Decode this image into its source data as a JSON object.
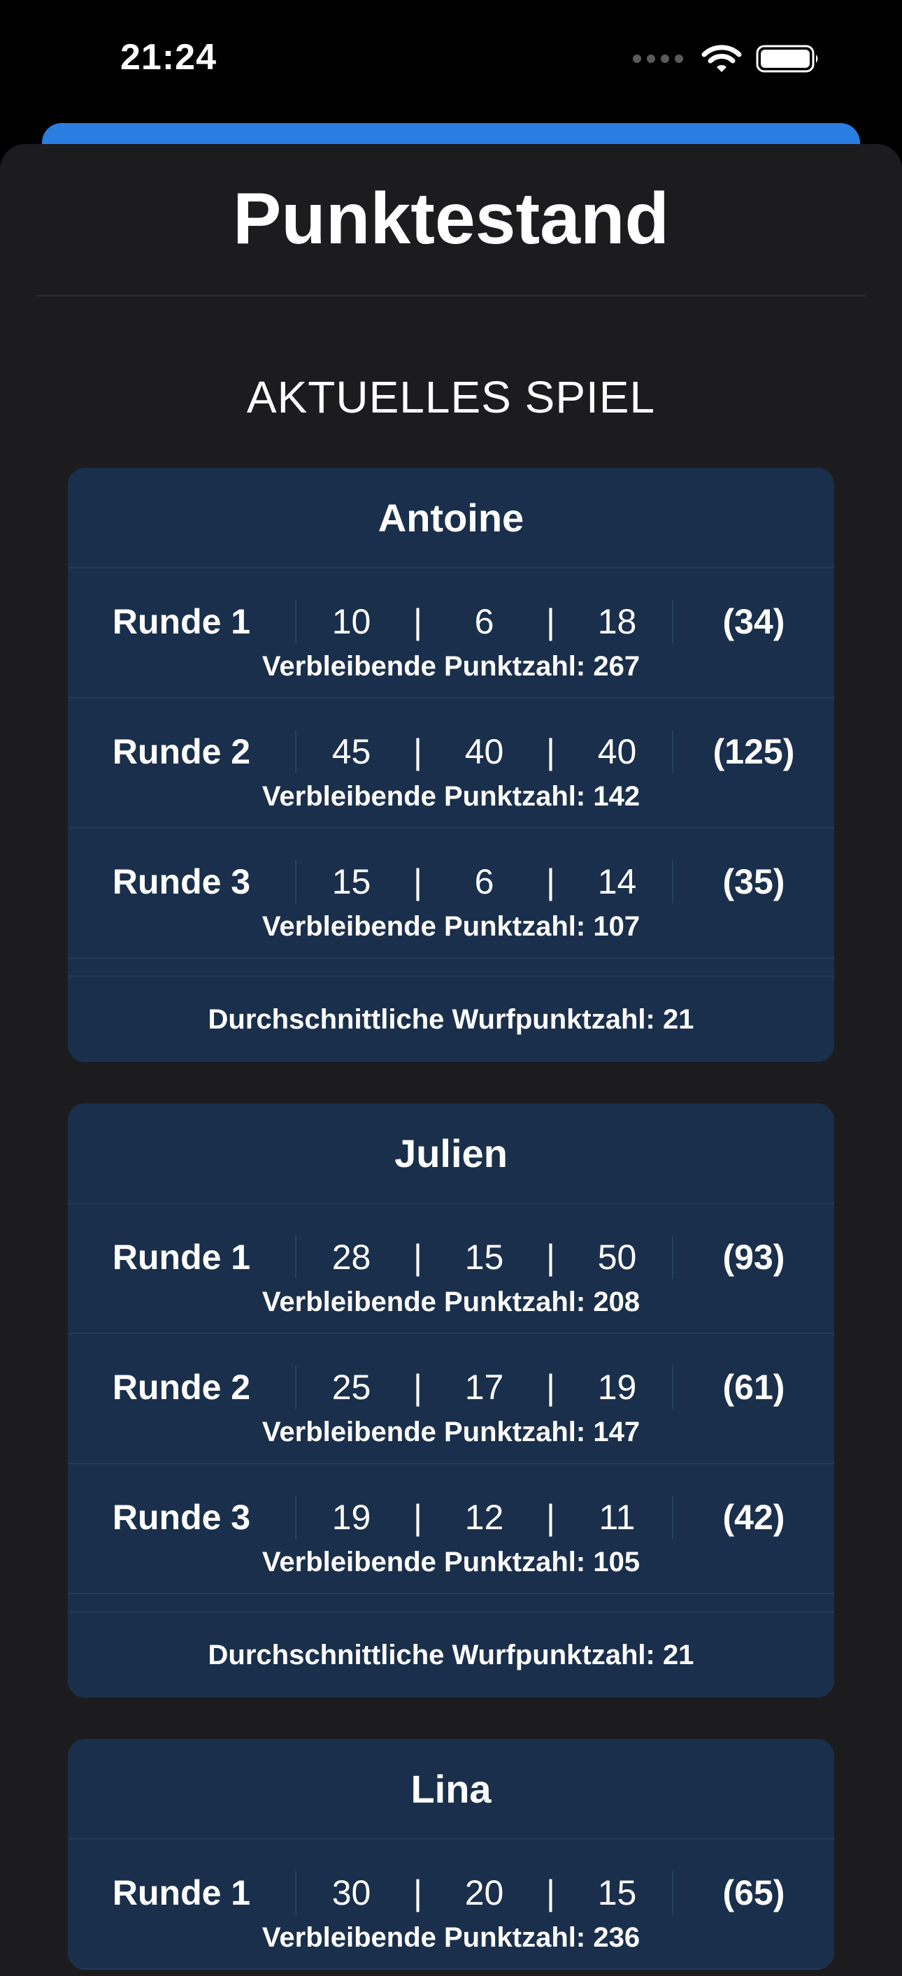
{
  "status_bar": {
    "time": "21:24"
  },
  "title": "Punktestand",
  "section_label": "AKTUELLES SPIEL",
  "players": [
    {
      "name": "Antoine",
      "rounds": [
        {
          "label": "Runde 1",
          "throws": [
            "10",
            "6",
            "18"
          ],
          "total": "(34)",
          "remaining": "Verbleibende Punktzahl: 267"
        },
        {
          "label": "Runde 2",
          "throws": [
            "45",
            "40",
            "40"
          ],
          "total": "(125)",
          "remaining": "Verbleibende Punktzahl: 142"
        },
        {
          "label": "Runde 3",
          "throws": [
            "15",
            "6",
            "14"
          ],
          "total": "(35)",
          "remaining": "Verbleibende Punktzahl: 107"
        }
      ],
      "average": "Durchschnittliche Wurfpunktzahl: 21"
    },
    {
      "name": "Julien",
      "rounds": [
        {
          "label": "Runde 1",
          "throws": [
            "28",
            "15",
            "50"
          ],
          "total": "(93)",
          "remaining": "Verbleibende Punktzahl: 208"
        },
        {
          "label": "Runde 2",
          "throws": [
            "25",
            "17",
            "19"
          ],
          "total": "(61)",
          "remaining": "Verbleibende Punktzahl: 147"
        },
        {
          "label": "Runde 3",
          "throws": [
            "19",
            "12",
            "11"
          ],
          "total": "(42)",
          "remaining": "Verbleibende Punktzahl: 105"
        }
      ],
      "average": "Durchschnittliche Wurfpunktzahl: 21"
    },
    {
      "name": "Lina",
      "rounds": [
        {
          "label": "Runde 1",
          "throws": [
            "30",
            "20",
            "15"
          ],
          "total": "(65)",
          "remaining": "Verbleibende Punktzahl: 236"
        }
      ]
    }
  ],
  "throw_separator": "|",
  "colors": {
    "accent": "#2a7de1",
    "card": "#1a2f4b",
    "sheet": "#1c1c1e"
  },
  "icons": [
    "signal-dots-icon",
    "wifi-icon",
    "battery-icon"
  ]
}
